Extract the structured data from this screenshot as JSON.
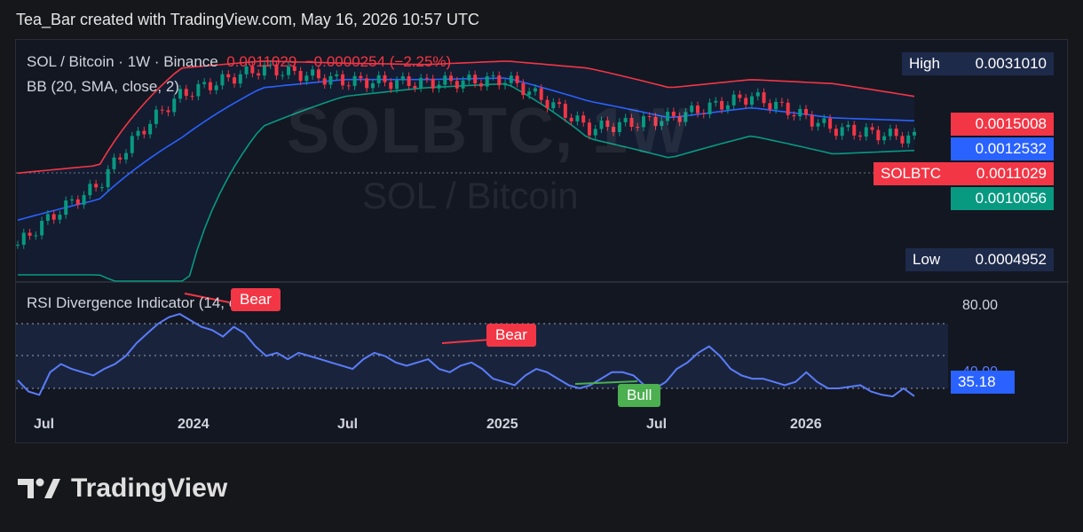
{
  "header": {
    "text": "Tea_Bar created with TradingView.com, May 16, 2026 10:57 UTC"
  },
  "legend": {
    "symbol": "SOL / Bitcoin · 1W · Binance",
    "price": "0.0011029",
    "change": "−0.0000254 (−2.25%)",
    "bb": "BB (20, SMA, close, 2)"
  },
  "watermark": {
    "ticker": "SOLBTC, 1W",
    "name": "SOL / Bitcoin"
  },
  "price_tags": {
    "high_label": "High",
    "high_value": "0.0031010",
    "upper": "0.0015008",
    "basis": "0.0012532",
    "ticker": "SOLBTC",
    "last": "0.0011029",
    "lower": "0.0010056",
    "low_label": "Low",
    "low_value": "0.0004952"
  },
  "rsi": {
    "label": "RSI Divergence Indicator (14, close)",
    "level_80": "80.00",
    "level_obscured": "40.00",
    "value": "35.18",
    "bear_label": "Bear",
    "bull_label": "Bull"
  },
  "x_axis": {
    "labels": [
      "Jul",
      "2024",
      "Jul",
      "2025",
      "Jul",
      "2026"
    ]
  },
  "footer": {
    "brand": "TradingView"
  },
  "colors": {
    "up": "#089981",
    "down": "#f23645",
    "upper_band": "#f23645",
    "basis": "#2962ff",
    "lower_band": "#089981",
    "rsi": "#5b7cfa",
    "bull": "#4caf50"
  },
  "chart_data": [
    {
      "type": "line",
      "title": "SOL / Bitcoin · 1W · Binance",
      "x": [
        "2023-07",
        "2023-10",
        "2024-01",
        "2024-04",
        "2024-07",
        "2024-10",
        "2025-01",
        "2025-04",
        "2025-07",
        "2025-10",
        "2026-01",
        "2026-05"
      ],
      "series": [
        {
          "name": "close",
          "values": [
            0.0005,
            0.00078,
            0.00152,
            0.00185,
            0.00168,
            0.00166,
            0.0017,
            0.00118,
            0.00128,
            0.0015,
            0.00118,
            0.0011029
          ]
        },
        {
          "name": "upper",
          "values": [
            0.00085,
            0.0009,
            0.00185,
            0.00195,
            0.00192,
            0.0019,
            0.00195,
            0.00185,
            0.0016,
            0.0017,
            0.00165,
            0.0015008
          ]
        },
        {
          "name": "basis",
          "values": [
            0.0006,
            0.0007,
            0.0011,
            0.0016,
            0.0017,
            0.0017,
            0.00172,
            0.00145,
            0.00128,
            0.00138,
            0.00128,
            0.0012532
          ]
        },
        {
          "name": "lower",
          "values": [
            0.0004,
            0.0004,
            0.0003,
            0.0012,
            0.0015,
            0.0016,
            0.00165,
            0.0011,
            0.00095,
            0.00112,
            0.00098,
            0.0010056
          ]
        }
      ],
      "high": 0.003101,
      "low": 0.0004952
    },
    {
      "type": "line",
      "title": "RSI Divergence Indicator (14, close)",
      "y_levels": [
        80,
        60,
        40
      ],
      "values": [
        45,
        38,
        36,
        50,
        55,
        52,
        50,
        48,
        52,
        55,
        60,
        68,
        74,
        80,
        84,
        86,
        82,
        78,
        76,
        72,
        78,
        74,
        66,
        60,
        62,
        58,
        62,
        60,
        58,
        56,
        54,
        52,
        58,
        62,
        60,
        56,
        54,
        56,
        58,
        52,
        50,
        54,
        56,
        52,
        46,
        44,
        42,
        48,
        52,
        50,
        46,
        42,
        40,
        42,
        46,
        50,
        50,
        48,
        42,
        40,
        44,
        52,
        56,
        62,
        66,
        60,
        52,
        48,
        46,
        46,
        44,
        42,
        44,
        50,
        44,
        40,
        40,
        41,
        42,
        38,
        36,
        35,
        40,
        35.18
      ],
      "last": 35.18,
      "divergences": [
        {
          "kind": "Bear",
          "from": "2024-01",
          "to": "2024-03"
        },
        {
          "kind": "Bear",
          "from": "2024-11",
          "to": "2025-01"
        },
        {
          "kind": "Bull",
          "from": "2025-04",
          "to": "2025-06"
        }
      ]
    }
  ]
}
